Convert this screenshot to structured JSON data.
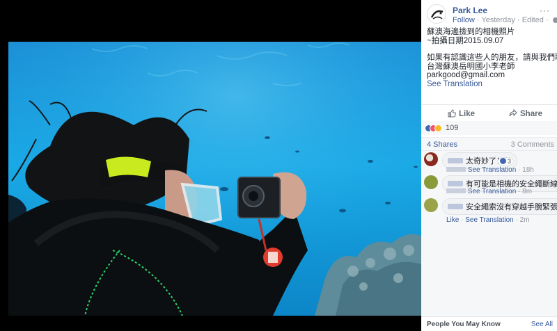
{
  "post": {
    "author": "Park Lee",
    "follow": "Follow",
    "sep": "·",
    "time": "Yesterday",
    "edited": "Edited",
    "more": "···",
    "lines": [
      "蘇澳海邊撿到的相機照片",
      "~拍攝日期2015.09.07",
      "",
      "如果有認識這些人的朋友，請與我們聯絡!",
      "台灣蘇澳岳明國小李老師",
      "parkgood@gmail.com"
    ],
    "see_translation": "See Translation"
  },
  "actions": {
    "like": "Like",
    "share": "Share"
  },
  "reactions": {
    "count": "109",
    "types": [
      "like",
      "love",
      "wow"
    ]
  },
  "stats": {
    "shares": "4 Shares",
    "comments": "3 Comments"
  },
  "comments": [
    {
      "text": "太奇妙了！！",
      "translation": "See Translation",
      "time": "18h",
      "likes": "3",
      "avatar_color": "#8a2a1f"
    },
    {
      "text": "有可能是相機的安全繩斷線掉了",
      "translation": "See Translation",
      "time": "8m",
      "avatar_color": "#8a9a3a"
    },
    {
      "text": "安全繩索沒有穿越手腕緊張就會落",
      "like": "Like",
      "translation": "See Translation",
      "time": "2m",
      "avatar_color": "#9aa34a"
    }
  ],
  "pymk": {
    "title": "People You May Know",
    "see_all": "See All"
  },
  "colors": {
    "link": "#365899",
    "muted": "#90949c",
    "ocean": "#1fa3dc"
  }
}
